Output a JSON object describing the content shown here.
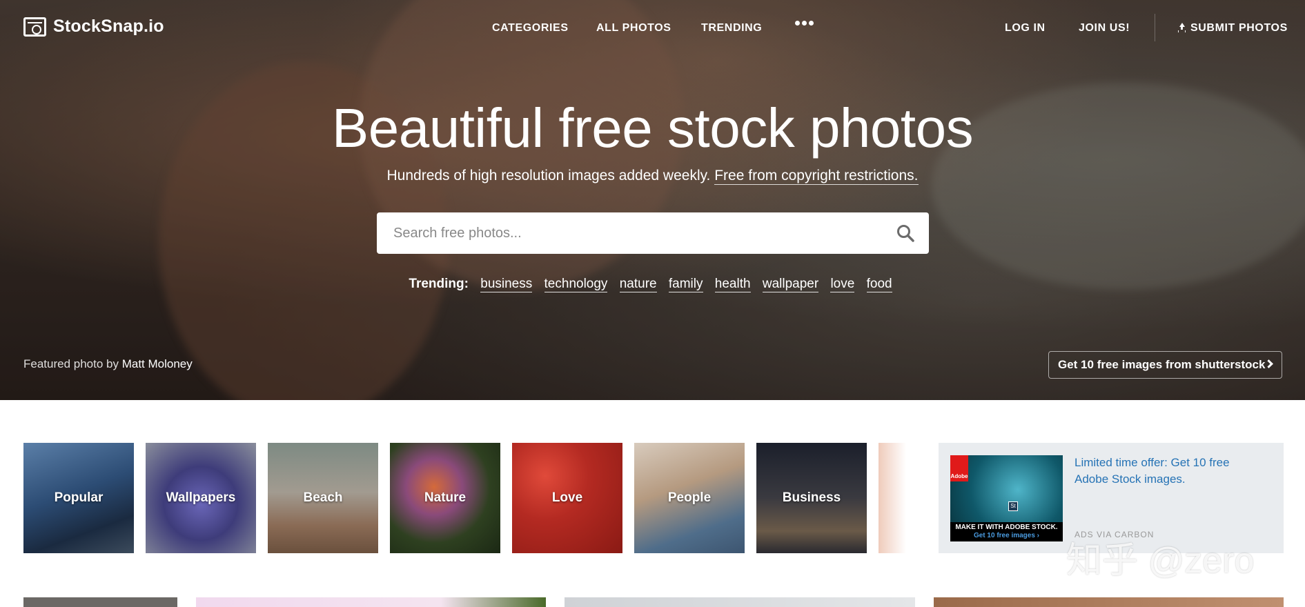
{
  "brand": {
    "name": "StockSnap.io"
  },
  "nav": {
    "categories": "CATEGORIES",
    "all_photos": "ALL PHOTOS",
    "trending": "TRENDING",
    "login": "LOG IN",
    "join": "JOIN US!",
    "submit": "SUBMIT PHOTOS"
  },
  "hero": {
    "headline": "Beautiful free stock photos",
    "subline": "Hundreds of high resolution images added weekly.",
    "subline_link": "Free from copyright restrictions.",
    "search_placeholder": "Search free photos...",
    "trending_label": "Trending:",
    "trending_tags": [
      "business",
      "technology",
      "nature",
      "family",
      "health",
      "wallpaper",
      "love",
      "food"
    ],
    "featured_prefix": "Featured photo by",
    "featured_author": "Matt Moloney",
    "shutterstock_button": "Get 10 free images from shutterstock"
  },
  "categories": [
    {
      "label": "Popular"
    },
    {
      "label": "Wallpapers"
    },
    {
      "label": "Beach"
    },
    {
      "label": "Nature"
    },
    {
      "label": "Love"
    },
    {
      "label": "People"
    },
    {
      "label": "Business"
    }
  ],
  "ad": {
    "text": "Limited time offer: Get 10 free Adobe Stock images.",
    "via": "ADS VIA CARBON",
    "image_brand": "Adobe",
    "image_badge": "St",
    "image_caption": "MAKE IT WITH ADOBE STOCK.",
    "image_cta": "Get 10 free images ›"
  },
  "watermark": "知乎 @zero",
  "colors": {
    "accent_link": "#2673b5",
    "ad_bg": "#e9ecef"
  }
}
